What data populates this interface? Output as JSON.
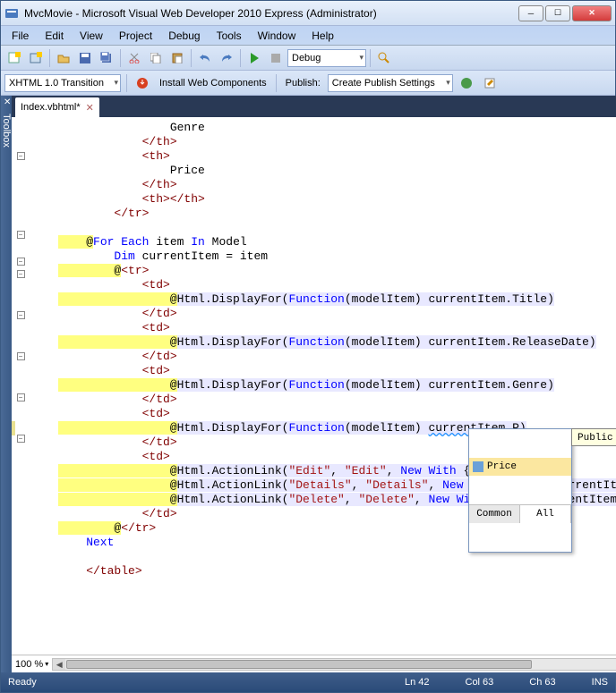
{
  "window": {
    "title": "MvcMovie - Microsoft Visual Web Developer 2010 Express (Administrator)"
  },
  "menu": {
    "items": [
      "File",
      "Edit",
      "View",
      "Project",
      "Debug",
      "Tools",
      "Window",
      "Help"
    ]
  },
  "toolbar1": {
    "config_dropdown": "Debug"
  },
  "toolbar2": {
    "doctype": "XHTML 1.0 Transition",
    "install": "Install Web Components",
    "publish_label": "Publish:",
    "publish_value": "Create Publish Settings"
  },
  "side": {
    "toolbox": "Toolbox"
  },
  "tab": {
    "name": "Index.vbhtml*"
  },
  "intellisense": {
    "item": "Price",
    "tab_common": "Common",
    "tab_all": "All",
    "tooltip": "Public Prope"
  },
  "bottom": {
    "zoom": "100 %"
  },
  "status": {
    "ready": "Ready",
    "ln": "Ln 42",
    "col": "Col 63",
    "ch": "Ch 63",
    "ins": "INS"
  },
  "code": {
    "l1": "                Genre",
    "l2": "            </th>",
    "l3": "            <th>",
    "l4": "                Price",
    "l5": "            </th>",
    "l6": "            <th></th>",
    "l7": "        </tr>",
    "l8": "",
    "l9_at": "    @",
    "l9_kw1": "For Each",
    "l9_t1": " item ",
    "l9_kw2": "In",
    "l9_t2": " Model",
    "l10_kw": "        Dim",
    "l10_t": " currentItem = item",
    "l11_at": "        @",
    "l11_tag": "<tr>",
    "l12": "            <td>",
    "l13_at": "                @",
    "l13_r": "Html.DisplayFor(",
    "l13_kw": "Function",
    "l13_r2": "(modelItem) currentItem.Title)",
    "l14": "            </td>",
    "l15": "            <td>",
    "l16_at": "                @",
    "l16_r": "Html.DisplayFor(",
    "l16_kw": "Function",
    "l16_r2": "(modelItem) currentItem.ReleaseDate)",
    "l17": "            </td>",
    "l18": "            <td>",
    "l19_at": "                @",
    "l19_r": "Html.DisplayFor(",
    "l19_kw": "Function",
    "l19_r2": "(modelItem) currentItem.Genre)",
    "l20": "            </td>",
    "l21": "            <td>",
    "l22_at": "                @",
    "l22_r": "Html.DisplayFor(",
    "l22_kw": "Function",
    "l22_r2": "(modelItem) ",
    "l22_w": "currentItem.P",
    "l22_end": ")",
    "l23": "            </td>",
    "l24": "            <td>",
    "l25_at": "                @",
    "l25_r": "Html.ActionLink(",
    "l25_s1": "\"Edit\"",
    "l25_c": ", ",
    "l25_s2": "\"Edit\"",
    "l25_c2": ", ",
    "l25_kw": "New With",
    "l25_t": " {.id =",
    "l26_at": "                @",
    "l26_r": "Html.ActionLink(",
    "l26_s1": "\"Details\"",
    "l26_c": ", ",
    "l26_s2": "\"Details\"",
    "l26_c2": ", ",
    "l26_kw": "New With",
    "l26_t": " {.id = currentItem.ID})",
    "l27_at": "                @",
    "l27_r": "Html.ActionLink(",
    "l27_s1": "\"Delete\"",
    "l27_c": ", ",
    "l27_s2": "\"Delete\"",
    "l27_c2": ", ",
    "l27_kw": "New With",
    "l27_t": " {.id = currentItem.ID})",
    "l28": "            </td>",
    "l29_at": "        @",
    "l29_tag": "</tr>",
    "l30_kw": "    Next",
    "l31": "",
    "l32": "    </table>"
  }
}
